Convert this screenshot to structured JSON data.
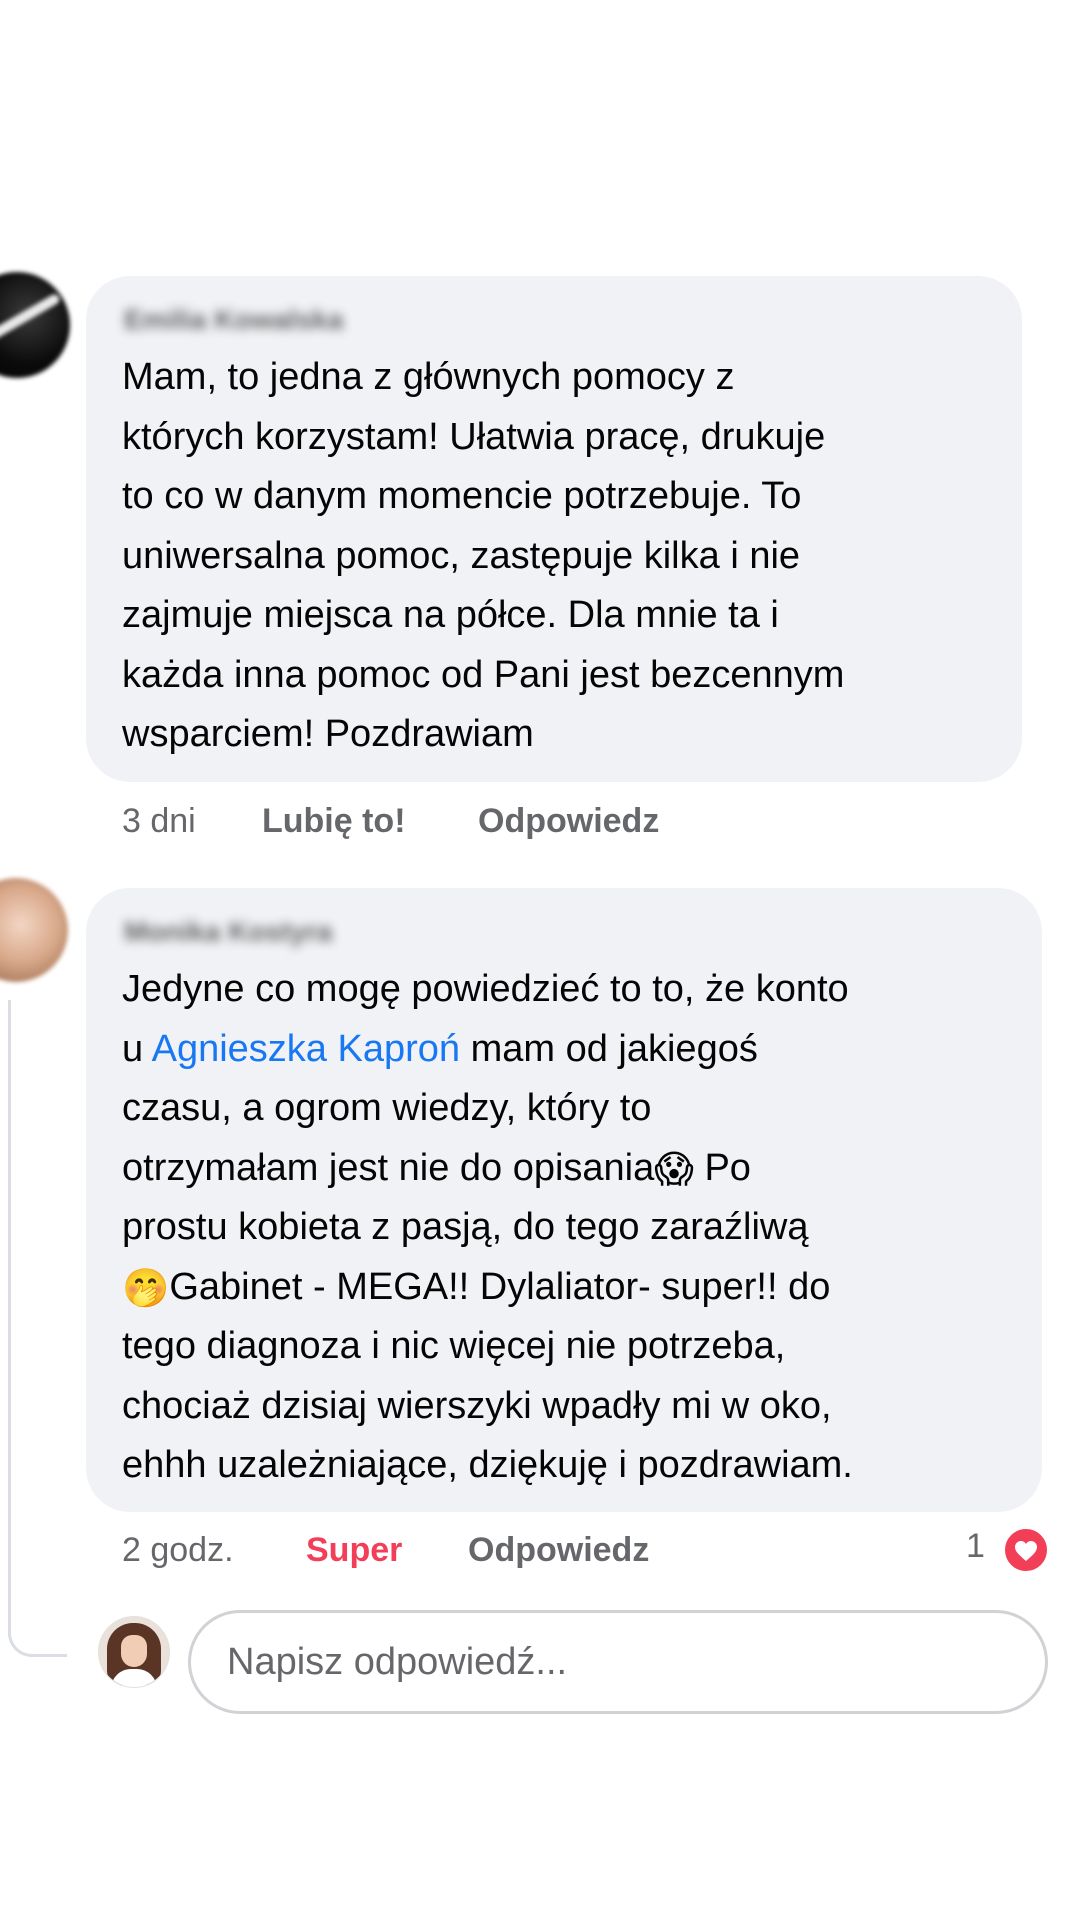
{
  "comments": [
    {
      "author": "Emilia Kowalska",
      "text": "Mam, to jedna z głównych pomocy z\nktórych korzystam! Ułatwia pracę, drukuje\nto co w danym momencie potrzebuje. To\nuniwersalna pomoc, zastępuje kilka i nie\nzajmuje miejsca na półce. Dla mnie ta i\nkażda inna pomoc od Pani jest bezcennym\nwsparciem! Pozdrawiam",
      "time": "3 dni",
      "like_label": "Lubię to!",
      "reply_label": "Odpowiedz"
    },
    {
      "author": "Monika Kostyra",
      "text_a": "Jedyne co mogę powiedzieć to to, że konto\nu ",
      "mention": "Agnieszka Kaproń",
      "text_b": " mam od jakiegoś\nczasu, a ogrom wiedzy, który to\notrzymałam jest nie do opisania",
      "emoji_1": "😱",
      "text_c": " Po\nprostu kobieta z pasją, do tego zaraźliwą\n",
      "emoji_2": "🤭",
      "text_d": "Gabinet - MEGA!! Dylaliator- super!! do\ntego diagnoza i nic więcej nie potrzeba,\nchociaż dzisiaj wierszyki wpadły mi w oko,\nehhh uzależniające, dziękuję i pozdrawiam.",
      "time": "2 godz.",
      "reaction_label": "Super",
      "reply_label": "Odpowiedz",
      "reaction_count": "1",
      "reaction_icon": "heart-icon",
      "reaction_color": "#f33e58"
    }
  ],
  "reply_box": {
    "placeholder": "Napisz odpowiedź..."
  },
  "colors": {
    "bubble": "#f0f2f5",
    "mention": "#1877f2",
    "muted": "#65676b"
  }
}
